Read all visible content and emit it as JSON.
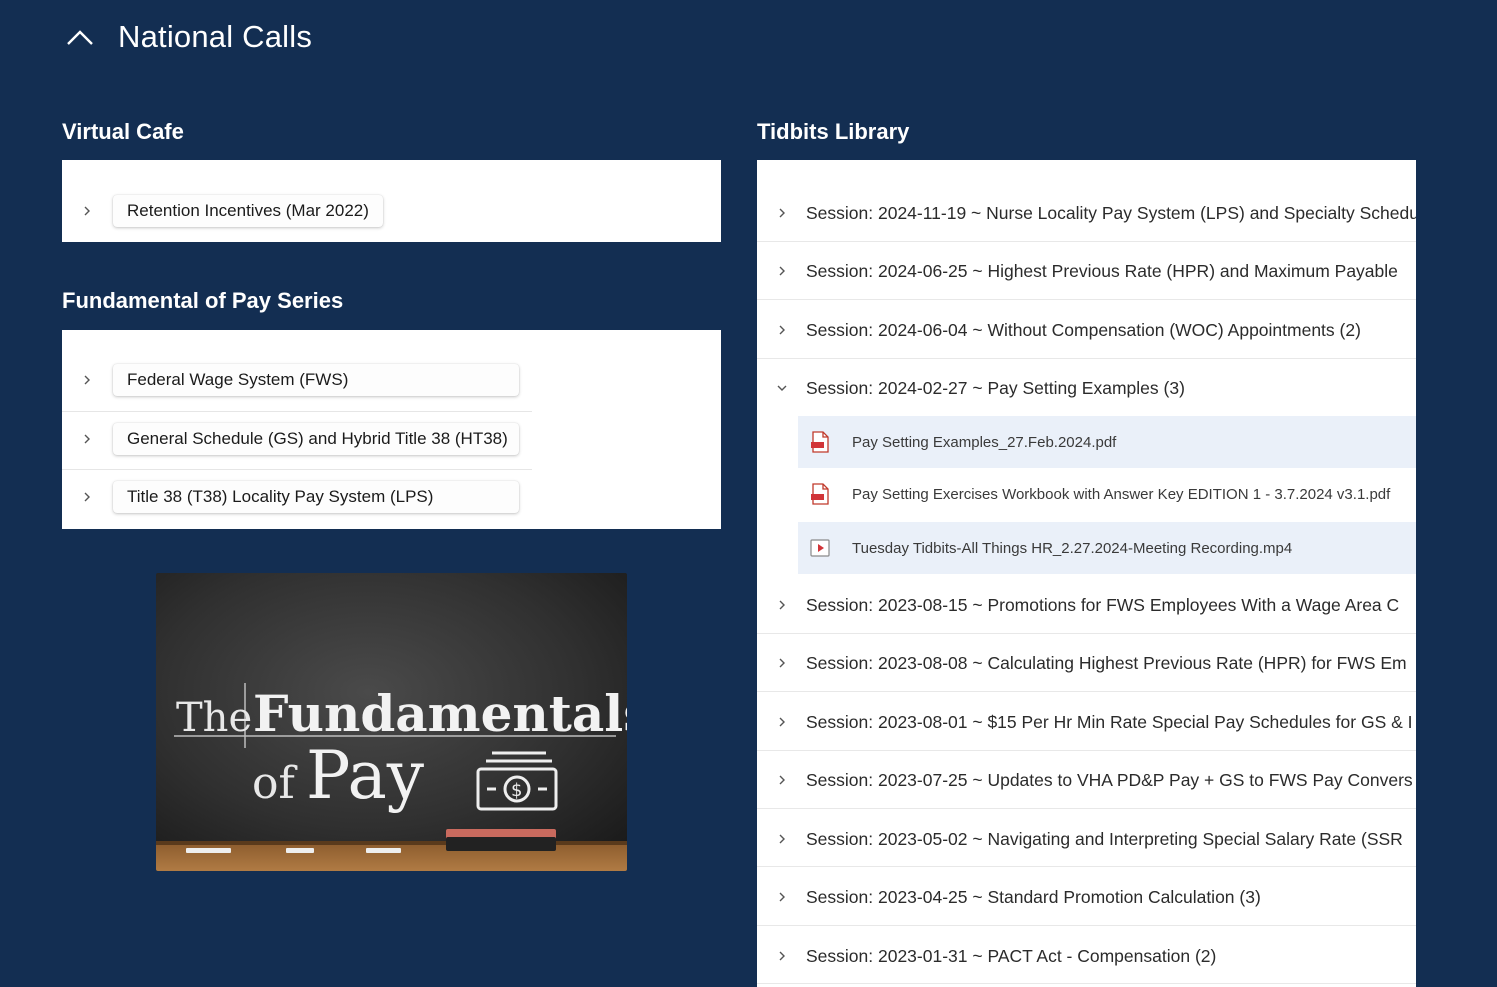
{
  "header": {
    "title": "National Calls",
    "collapse_icon": "chevron-up-icon"
  },
  "virtual_cafe": {
    "title": "Virtual Cafe",
    "items": [
      {
        "label": "Retention Incentives (Mar 2022)"
      }
    ]
  },
  "fundamentals": {
    "title": "Fundamental of Pay Series",
    "items": [
      {
        "label": "Federal Wage System (FWS)"
      },
      {
        "label": "General Schedule (GS) and Hybrid Title 38 (HT38)"
      },
      {
        "label": "Title 38 (T38) Locality Pay System (LPS)"
      }
    ],
    "image": {
      "line1": "The",
      "line2": "Fundamentals",
      "line3": "of",
      "line4": "Pay",
      "icon": "money-icon"
    }
  },
  "tidbits": {
    "title": "Tidbits Library",
    "sessions": [
      {
        "label": "Session: 2024-11-19 ~ Nurse Locality Pay System (LPS) and Specialty Schedu"
      },
      {
        "label": "Session: 2024-06-25 ~ Highest Previous Rate (HPR) and Maximum Payable"
      },
      {
        "label": "Session: 2024-06-04 ~ Without Compensation (WOC) Appointments (2)"
      },
      {
        "label": "Session: 2024-02-27 ~ Pay Setting Examples (3)",
        "expanded": true
      },
      {
        "label": "Session: 2023-08-15 ~ Promotions for FWS Employees With a Wage Area C"
      },
      {
        "label": "Session: 2023-08-08 ~ Calculating Highest Previous Rate (HPR) for FWS Em"
      },
      {
        "label": "Session: 2023-08-01 ~ $15 Per Hr Min Rate Special Pay Schedules for GS & I"
      },
      {
        "label": "Session: 2023-07-25 ~ Updates to VHA PD&P Pay + GS to FWS Pay Convers"
      },
      {
        "label": "Session: 2023-05-02 ~ Navigating and Interpreting Special Salary Rate (SSR"
      },
      {
        "label": "Session: 2023-04-25 ~ Standard Promotion Calculation (3)"
      },
      {
        "label": "Session: 2023-01-31 ~ PACT Act - Compensation (2)"
      }
    ],
    "files": [
      {
        "name": "Pay Setting Examples_27.Feb.2024.pdf",
        "icon": "pdf-file-icon"
      },
      {
        "name": "Pay Setting Exercises Workbook with Answer Key EDITION 1 - 3.7.2024 v3.1.pdf",
        "icon": "pdf-file-icon"
      },
      {
        "name": "Tuesday Tidbits-All Things HR_2.27.2024-Meeting Recording.mp4",
        "icon": "video-file-icon"
      }
    ]
  },
  "colors": {
    "background": "#132e52",
    "panel": "#ffffff",
    "highlight": "#eaf0f9",
    "pdf": "#d13438"
  }
}
